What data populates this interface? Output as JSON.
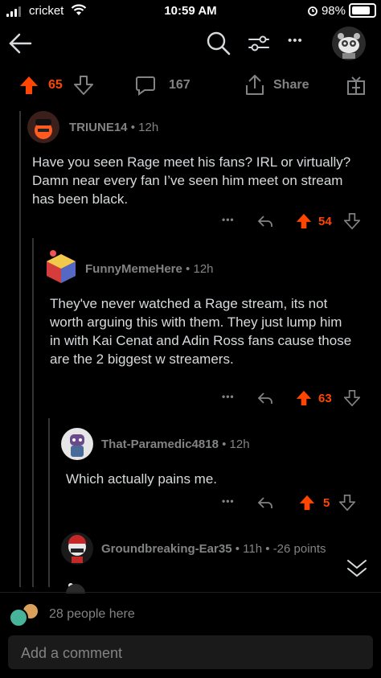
{
  "status_bar": {
    "carrier": "cricket",
    "time": "10:59 AM",
    "battery": "98%"
  },
  "post_actions": {
    "upvotes": "65",
    "comments": "167",
    "share_label": "Share"
  },
  "comments": [
    {
      "user": "TRIUNE14",
      "age": "12h",
      "text": "Have you seen Rage meet his fans? IRL or virtually? Damn near every fan I’ve seen him meet on stream has been black.",
      "score": "54"
    },
    {
      "user": "FunnyMemeHere",
      "age": "12h",
      "text": "They've never watched a Rage stream, its not worth arguing this with them. They just lump him in with Kai Cenat and Adin Ross fans cause those are the 2 biggest w streamers.",
      "score": "63"
    },
    {
      "user": "That-Paramedic4818",
      "age": "12h",
      "text": "Which actually pains me.",
      "score": "5"
    },
    {
      "user": "Groundbreaking-Ear35",
      "age": "11h",
      "points": "-26 points"
    }
  ],
  "separator": "•",
  "more_dots": "•••",
  "people_here": "28 people here",
  "comment_input": {
    "placeholder": "Add a comment"
  },
  "colors": {
    "upvote": "#ff4500",
    "background": "#000000",
    "text": "#d7dadc",
    "muted": "#818384"
  },
  "icons": [
    "back-arrow-icon",
    "search-icon",
    "filter-icon",
    "more-icon",
    "snoo-avatar",
    "upvote-icon",
    "downvote-icon",
    "comment-bubble-icon",
    "share-icon",
    "award-icon",
    "reply-icon",
    "collapse-chevron-icon"
  ]
}
